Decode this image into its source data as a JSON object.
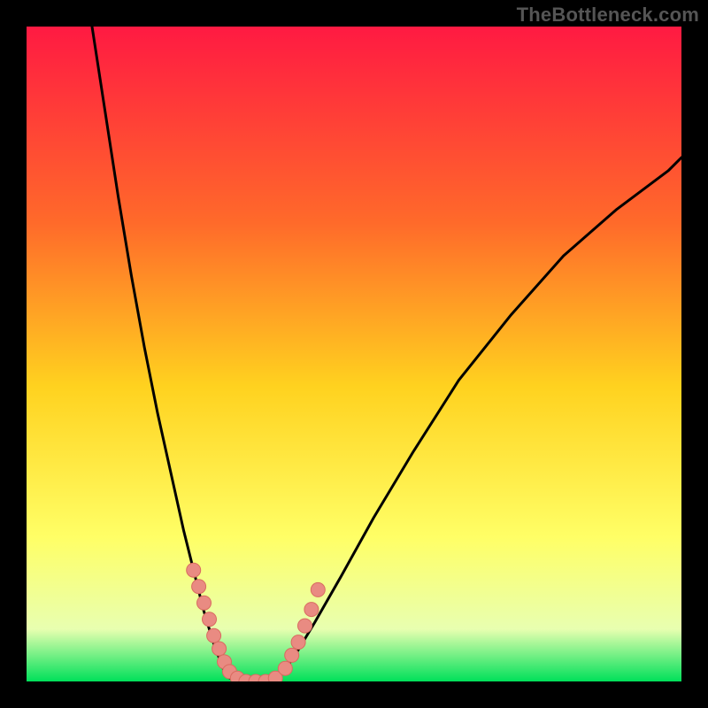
{
  "watermark": "TheBottleneck.com",
  "colors": {
    "gradient_top": "#ff1a42",
    "gradient_mid1": "#ff6a2a",
    "gradient_mid2": "#ffd21f",
    "gradient_mid3": "#ffff66",
    "gradient_mid4": "#e8ffb0",
    "gradient_bottom": "#00e05a",
    "curve": "#000000",
    "marker_fill": "#e98b82",
    "marker_stroke": "#d96b60"
  },
  "chart_data": {
    "type": "line",
    "title": "",
    "xlabel": "",
    "ylabel": "",
    "xlim": [
      0,
      100
    ],
    "ylim": [
      0,
      100
    ],
    "series": [
      {
        "name": "curve-left",
        "x": [
          10,
          12,
          14,
          16,
          18,
          20,
          22,
          24,
          25.5,
          27,
          28.5,
          30,
          31
        ],
        "y": [
          100,
          87,
          74,
          62,
          51,
          41,
          32,
          23,
          17,
          11,
          6,
          2,
          0.5
        ]
      },
      {
        "name": "curve-bottom",
        "x": [
          31,
          33,
          35,
          37,
          38.5
        ],
        "y": [
          0.5,
          0,
          0,
          0,
          0.5
        ]
      },
      {
        "name": "curve-right",
        "x": [
          38.5,
          41,
          44,
          48,
          53,
          59,
          66,
          74,
          82,
          90,
          98,
          100
        ],
        "y": [
          0.5,
          4,
          9,
          16,
          25,
          35,
          46,
          56,
          65,
          72,
          78,
          80
        ]
      }
    ],
    "markers": {
      "name": "data-points",
      "x": [
        25.5,
        26.3,
        27.1,
        27.9,
        28.6,
        29.4,
        30.2,
        31.0,
        32.2,
        33.5,
        35.0,
        36.5,
        38.0,
        39.5,
        40.5,
        41.5,
        42.5,
        43.5,
        44.5
      ],
      "y": [
        17,
        14.5,
        12,
        9.5,
        7,
        5,
        3,
        1.5,
        0.5,
        0,
        0,
        0,
        0.5,
        2,
        4,
        6,
        8.5,
        11,
        14
      ]
    }
  }
}
